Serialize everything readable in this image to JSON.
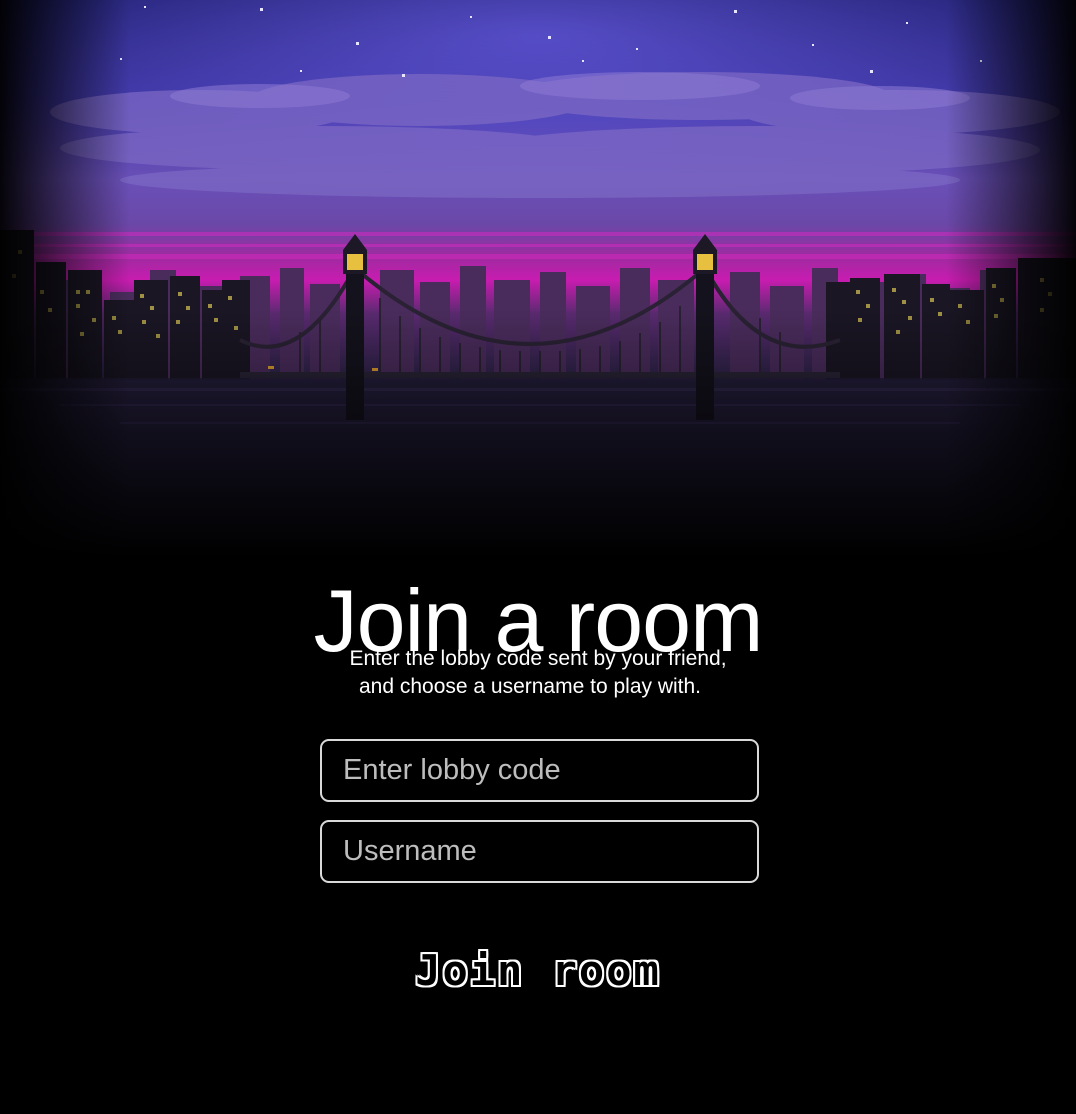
{
  "page": {
    "title": "Join a room",
    "subtitle_line1": "Enter the lobby code sent by your friend,",
    "subtitle_line2": "and choose a username to play with."
  },
  "form": {
    "lobby_placeholder": "Enter lobby code",
    "lobby_value": "",
    "username_placeholder": "Username",
    "username_value": "",
    "submit_label": "Join room"
  },
  "hero": {
    "scene": "pixel-art night city with suspension bridge",
    "colors": {
      "sky_top": "#2a2a8c",
      "sky_mid": "#5c44b0",
      "horizon": "#b01aa8",
      "water": "#221c3c",
      "lamp": "#e8c040"
    }
  }
}
